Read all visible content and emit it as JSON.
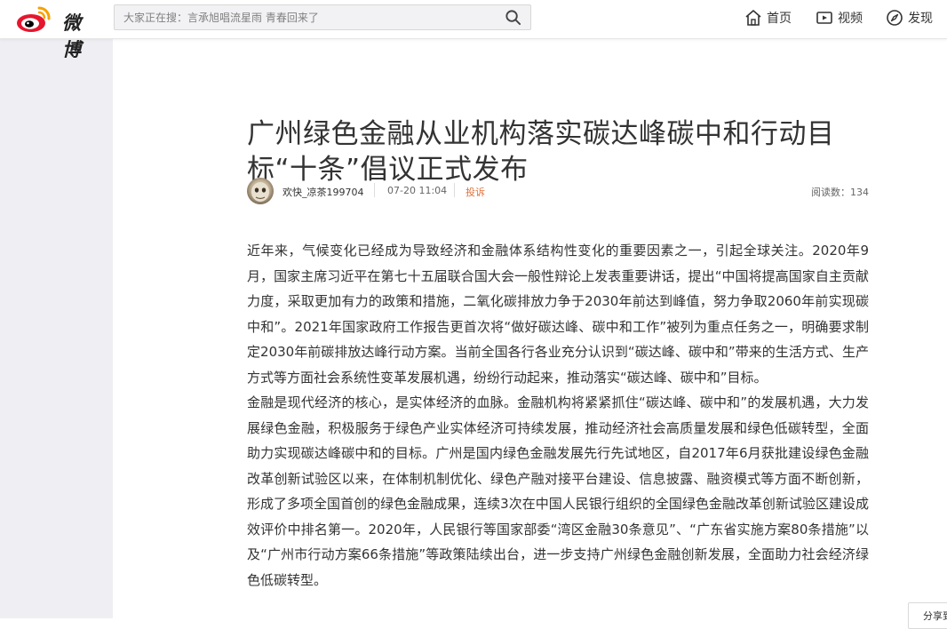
{
  "header": {
    "logo_text": "微博",
    "search_placeholder": "大家正在搜：言承旭唱流星雨 青春回来了",
    "nav": [
      {
        "label": "首页",
        "icon": "home-icon"
      },
      {
        "label": "视频",
        "icon": "video-icon"
      },
      {
        "label": "发现",
        "icon": "compass-icon"
      }
    ]
  },
  "article": {
    "title": "广州绿色金融从业机构落实碳达峰碳中和行动目标“十条”倡议正式发布",
    "author": "欢快_凉茶199704",
    "time": "07-20 11:04",
    "report": "投诉",
    "reads": "阅读数：134",
    "paragraphs": [
      "近年来，气候变化已经成为导致经济和金融体系结构性变化的重要因素之一，引起全球关注。2020年9月，国家主席习近平在第七十五届联合国大会一般性辩论上发表重要讲话，提出“中国将提高国家自主贡献力度，采取更加有力的政策和措施，二氧化碳排放力争于2030年前达到峰值，努力争取2060年前实现碳中和”。2021年国家政府工作报告更首次将“做好碳达峰、碳中和工作”被列为重点任务之一，明确要求制定2030年前碳排放达峰行动方案。当前全国各行各业充分认识到“碳达峰、碳中和”带来的生活方式、生产方式等方面社会系统性变革发展机遇，纷纷行动起来，推动落实“碳达峰、碳中和”目标。",
      "金融是现代经济的核心，是实体经济的血脉。金融机构将紧紧抓住“碳达峰、碳中和”的发展机遇，大力发展绿色金融，积极服务于绿色产业实体经济可持续发展，推动经济社会高质量发展和绿色低碳转型，全面助力实现碳达峰碳中和的目标。广州是国内绿色金融发展先行先试地区，自2017年6月获批建设绿色金融改革创新试验区以来，在体制机制优化、绿色产融对接平台建设、信息披露、融资模式等方面不断创新，形成了多项全国首创的绿色金融成果，连续3次在中国人民银行组织的全国绿色金融改革创新试验区建设成效评价中排名第一。2020年，人民银行等国家部委“湾区金融30条意见”、“广东省实施方案80条措施”以及“广州市行动方案66条措施”等政策陆续出台，进一步支持广州绿色金融创新发展，全面助力社会经济绿色低碳转型。"
    ]
  },
  "share_tab": "分享到"
}
